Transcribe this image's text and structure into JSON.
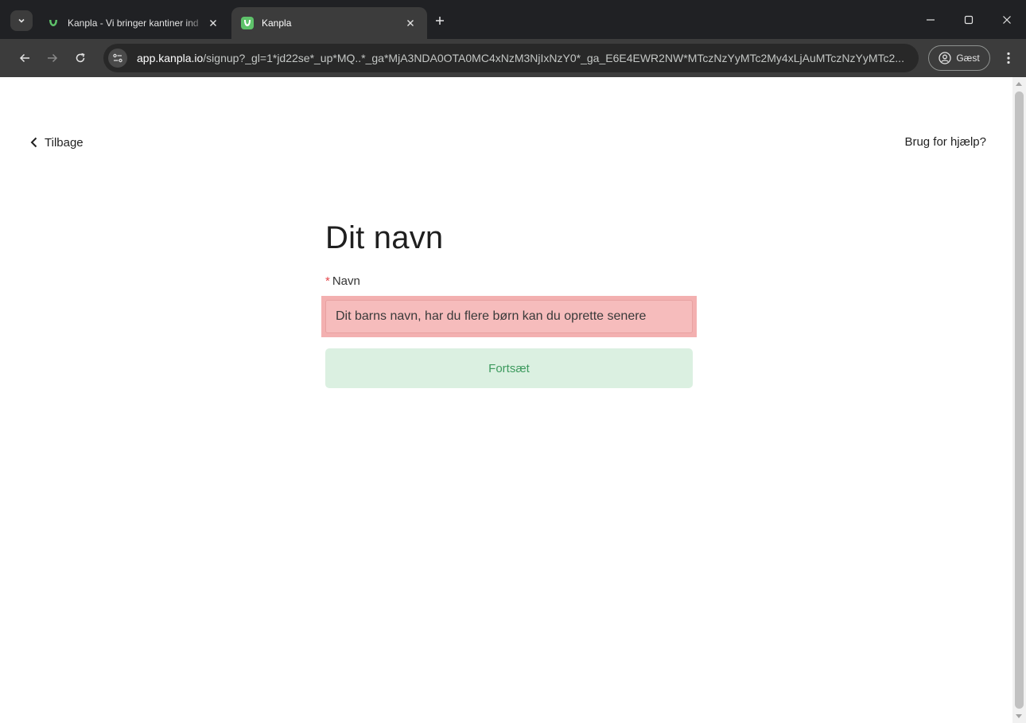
{
  "browser": {
    "tabs": [
      {
        "title": "Kanpla - Vi bringer kantiner ind",
        "active": false
      },
      {
        "title": "Kanpla",
        "active": true
      }
    ],
    "url_host": "app.kanpla.io",
    "url_path": "/signup?_gl=1*jd22se*_up*MQ..*_ga*MjA3NDA0OTA0MC4xNzM3NjIxNzY0*_ga_E6E4EWR2NW*MTczNzYyMTc2My4xLjAuMTczNzYyMTc2...",
    "profile_label": "Gæst"
  },
  "page": {
    "back_label": "Tilbage",
    "help_label": "Brug for hjælp?",
    "heading": "Dit navn",
    "field": {
      "required_mark": "*",
      "label": "Navn",
      "placeholder": "Dit barns navn, har du flere børn kan du oprette senere",
      "value": ""
    },
    "continue_label": "Fortsæt"
  },
  "colors": {
    "brand_green": "#3d9a5e",
    "button_bg": "#dbf0e1",
    "input_highlight": "#f3b0b0",
    "required": "#e5484d"
  }
}
